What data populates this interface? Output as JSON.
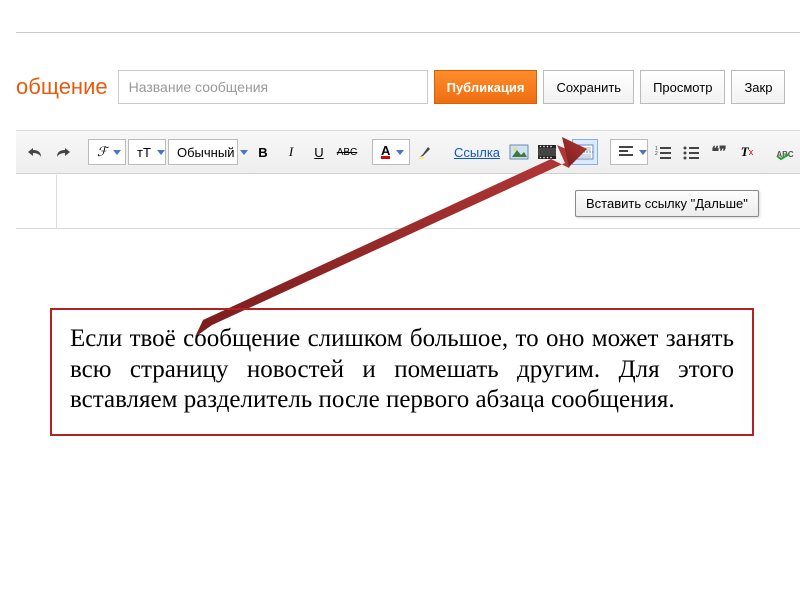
{
  "header": {
    "title_fragment": "общение",
    "title_placeholder": "Название сообщения",
    "publish": "Публикация",
    "save": "Сохранить",
    "preview": "Просмотр",
    "close": "Закр"
  },
  "toolbar": {
    "font_dd": "ℱ",
    "size_dd": "тT",
    "style_dd": "Обычный",
    "bold": "B",
    "italic": "I",
    "underline": "U",
    "strike": "ABC",
    "textcolor": "A",
    "link_label": "Ссылка",
    "quote": "❝❞",
    "remove_fmt": "Tx",
    "spell": "ABC"
  },
  "tooltip": "Вставить ссылку \"Дальше\"",
  "info_text": "Если твоё сообщение слишком большое, то оно может занять всю страницу новостей и помешать другим. Для этого вставляем разделитель  после первого абзаца сообщения."
}
